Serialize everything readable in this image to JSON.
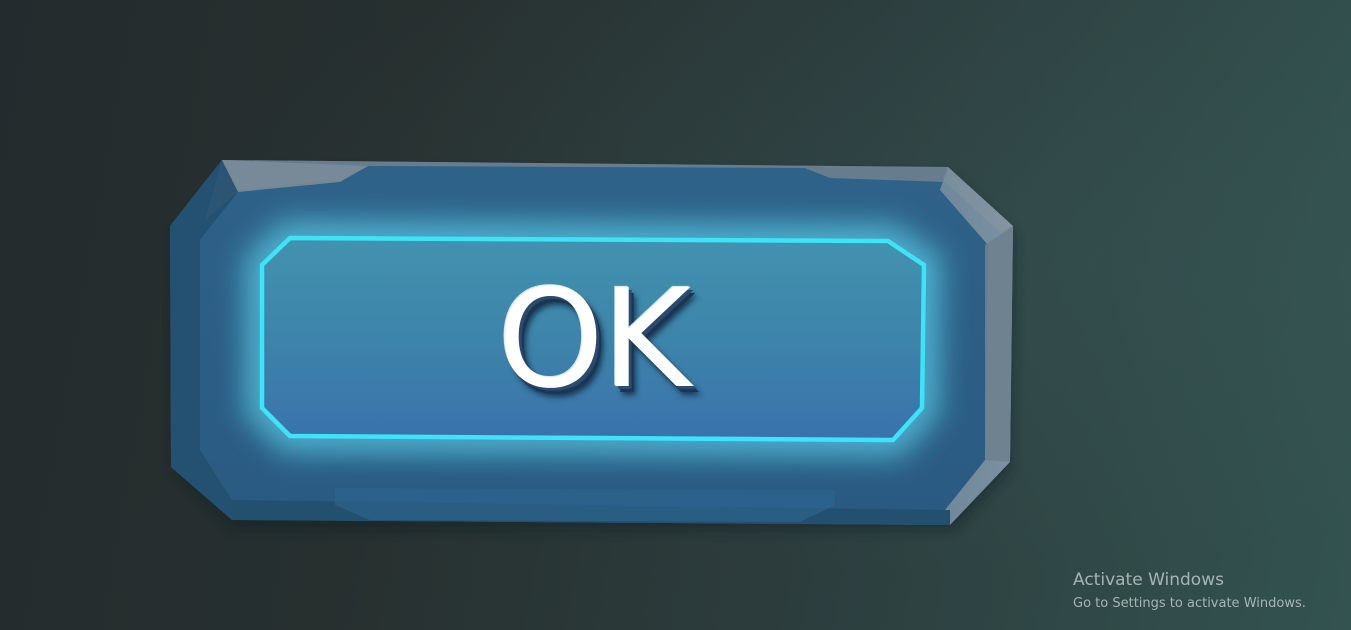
{
  "button": {
    "label": "OK",
    "colors": {
      "outer_frame": "#2c5b82",
      "inner_panel_top": "#3e88aa",
      "inner_panel_bottom": "#3a74aa",
      "glow_border": "#3de3f6"
    }
  },
  "watermark": {
    "title": "Activate Windows",
    "subtitle": "Go to Settings to activate Windows."
  }
}
